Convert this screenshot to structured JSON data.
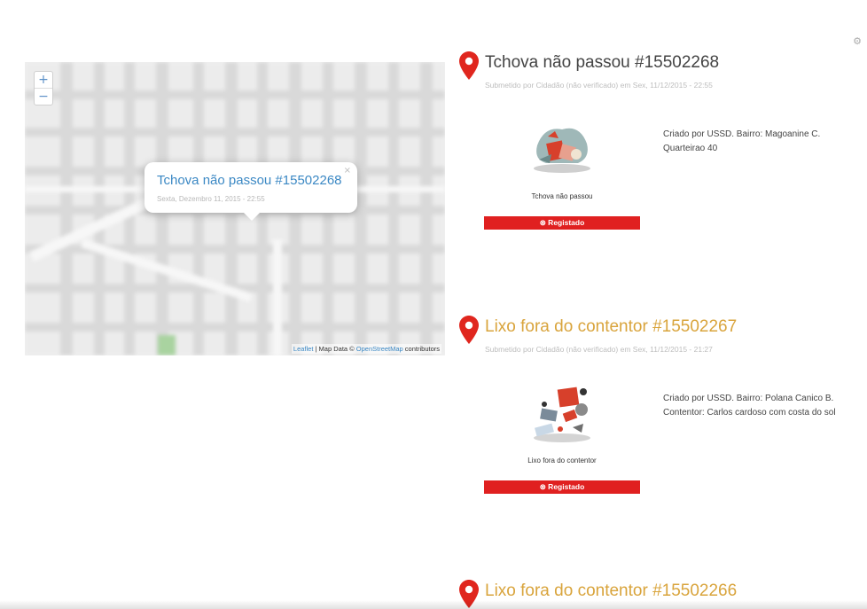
{
  "colors": {
    "pin": "#e0261e",
    "title_dark": "#444444",
    "title_gold": "#d9a43c",
    "status_red": "#e02020",
    "link_blue": "#3b88c4"
  },
  "map": {
    "zoom_in": "+",
    "zoom_out": "−",
    "popup": {
      "title": "Tchova não passou #15502268",
      "subtitle": "Sexta, Dezembro 11, 2015 - 22:55",
      "close": "×"
    },
    "attribution": {
      "leaflet": "Leaflet",
      "sep": " | Map Data © ",
      "osm": "OpenStreetMap",
      "contributors": " contributors"
    }
  },
  "settings_icon": "⚙",
  "reports": [
    {
      "title": "Tchova não passou #15502268",
      "submitted": "Submetido por Cidadão (não verificado) em Sex, 11/12/2015 - 22:55",
      "category_label": "Tchova não passou",
      "category_icon": "trash-pile-icon",
      "status": "⊗ Registado",
      "description": "Criado por USSD. Bairro: Magoanine C. Quarteirao 40"
    },
    {
      "title": "Lixo fora do contentor #15502267",
      "submitted": "Submetido por Cidadão (não verificado) em Sex, 11/12/2015 - 21:27",
      "category_label": "Lixo fora do contentor",
      "category_icon": "scattered-trash-icon",
      "status": "⊗ Registado",
      "description": "Criado por USSD. Bairro: Polana Canico B. Contentor: Carlos cardoso com costa do sol"
    },
    {
      "title": "Lixo fora do contentor #15502266"
    }
  ]
}
